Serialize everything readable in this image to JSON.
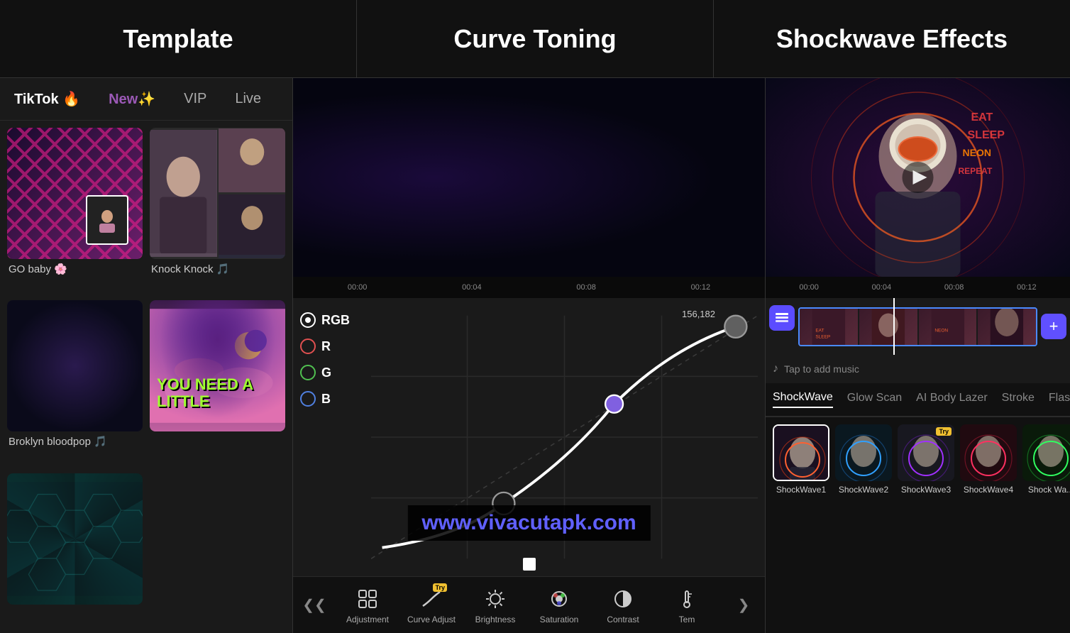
{
  "header": {
    "template_title": "Template",
    "curve_title": "Curve Toning",
    "shockwave_title": "Shockwave Effects"
  },
  "tabs": {
    "tiktok": "TikTok 🔥",
    "new": "New✨",
    "vip": "VIP",
    "live": "Live"
  },
  "templates": [
    {
      "id": "go-baby",
      "label": "GO baby 🌸"
    },
    {
      "id": "knock-knock",
      "label": "Knock Knock 🎵"
    },
    {
      "id": "brooklyn",
      "label": "Broklyn bloodpop 🎵"
    },
    {
      "id": "you-need",
      "label": ""
    },
    {
      "id": "hexagon",
      "label": ""
    }
  ],
  "curve": {
    "value_label": "156,182",
    "channels": [
      {
        "id": "rgb",
        "label": "RGB"
      },
      {
        "id": "r",
        "label": "R"
      },
      {
        "id": "g",
        "label": "G"
      },
      {
        "id": "b",
        "label": "B"
      }
    ]
  },
  "timeline": {
    "markers": [
      "00:00",
      "00:04",
      "00:08",
      "00:12"
    ]
  },
  "toolbar": {
    "items": [
      {
        "id": "adjustment",
        "label": "Adjustment",
        "icon": "⊞",
        "try": false
      },
      {
        "id": "curve-adjust",
        "label": "Curve Adjust",
        "icon": "〜",
        "try": true
      },
      {
        "id": "brightness",
        "label": "Brightness",
        "icon": "☀",
        "try": false
      },
      {
        "id": "saturation",
        "label": "Saturation",
        "icon": "◎",
        "try": false
      },
      {
        "id": "contrast",
        "label": "Contrast",
        "icon": "◑",
        "try": false
      },
      {
        "id": "temperature",
        "label": "Tem",
        "icon": "🌡",
        "try": false
      }
    ]
  },
  "effects": {
    "tabs": [
      {
        "id": "shockwave",
        "label": "ShockWave",
        "active": true
      },
      {
        "id": "glow-scan",
        "label": "Glow Scan"
      },
      {
        "id": "ai-body",
        "label": "AI Body Lazer"
      },
      {
        "id": "stroke",
        "label": "Stroke"
      },
      {
        "id": "flash",
        "label": "Flash"
      }
    ],
    "items": [
      {
        "id": "shockwave1",
        "label": "ShockWave1",
        "try": false
      },
      {
        "id": "shockwave2",
        "label": "ShockWave2",
        "try": false
      },
      {
        "id": "shockwave3",
        "label": "ShockWave3",
        "try": true
      },
      {
        "id": "shockwave4",
        "label": "ShockWave4",
        "try": false
      },
      {
        "id": "shockwave5",
        "label": "Shock Wa..."
      }
    ]
  },
  "watermark": "www.vivacutapk.com",
  "music": "Tap to add music"
}
